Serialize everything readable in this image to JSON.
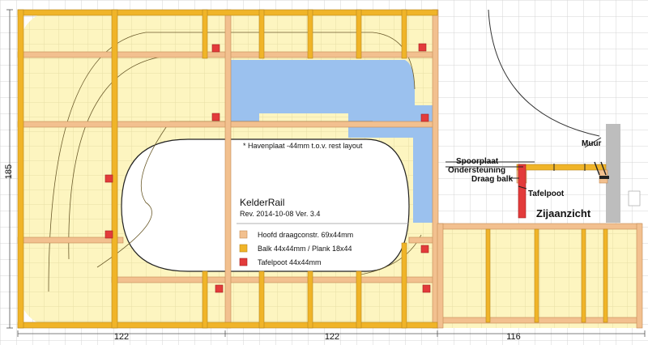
{
  "dimensions": {
    "left_height": "185",
    "bottom_left": "122",
    "bottom_middle": "122",
    "bottom_right": "116"
  },
  "layout_info": {
    "note": "* Havenplaat -44mm t.o.v. rest layout",
    "title": "KelderRail",
    "revision": "Rev. 2014-10-08 Ver. 3.4"
  },
  "legend": [
    {
      "label": "Hoofd draagconstr. 69x44mm",
      "color": "#f2c08f"
    },
    {
      "label": "Balk 44x44mm / Plank 18x44",
      "color": "#f0b428"
    },
    {
      "label": "Tafelpoot 44x44mm",
      "color": "#e33b3b"
    }
  ],
  "side_view": {
    "title": "Zijaanzicht",
    "wall": "Muur",
    "track_board": "Spoorplaat",
    "support": "Ondersteuning",
    "beam": "Draag balk",
    "leg": "Tafelpoot"
  },
  "colors": {
    "board": "#fdf5c0",
    "grid_light": "#e6dca0",
    "grid_bg": "#d8d8d8",
    "water": "#9bc1ee",
    "main_beam": "#f2c08f",
    "beam": "#f0b428",
    "leg": "#e33b3b",
    "wall": "#bdbdbd"
  }
}
